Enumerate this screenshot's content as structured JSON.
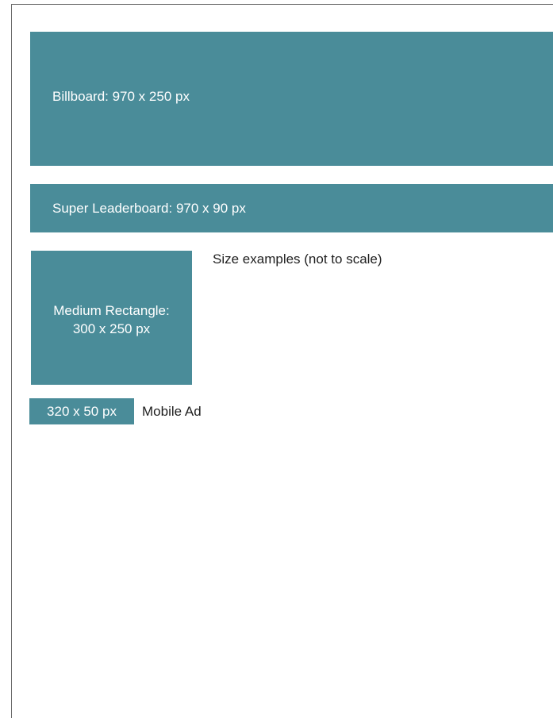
{
  "ads": {
    "billboard": "Billboard: 970 x 250 px",
    "super_leaderboard": "Super Leaderboard: 970 x 90 px",
    "medium_rectangle_line1": "Medium Rectangle:",
    "medium_rectangle_line2": "300 x 250 px",
    "mobile_size": "320 x 50 px"
  },
  "captions": {
    "examples_note": "Size examples (not to scale)",
    "mobile_label": "Mobile Ad"
  },
  "colors": {
    "ad_fill": "#4a8c99",
    "ad_text": "#ffffff",
    "caption_text": "#1f1f1f"
  }
}
